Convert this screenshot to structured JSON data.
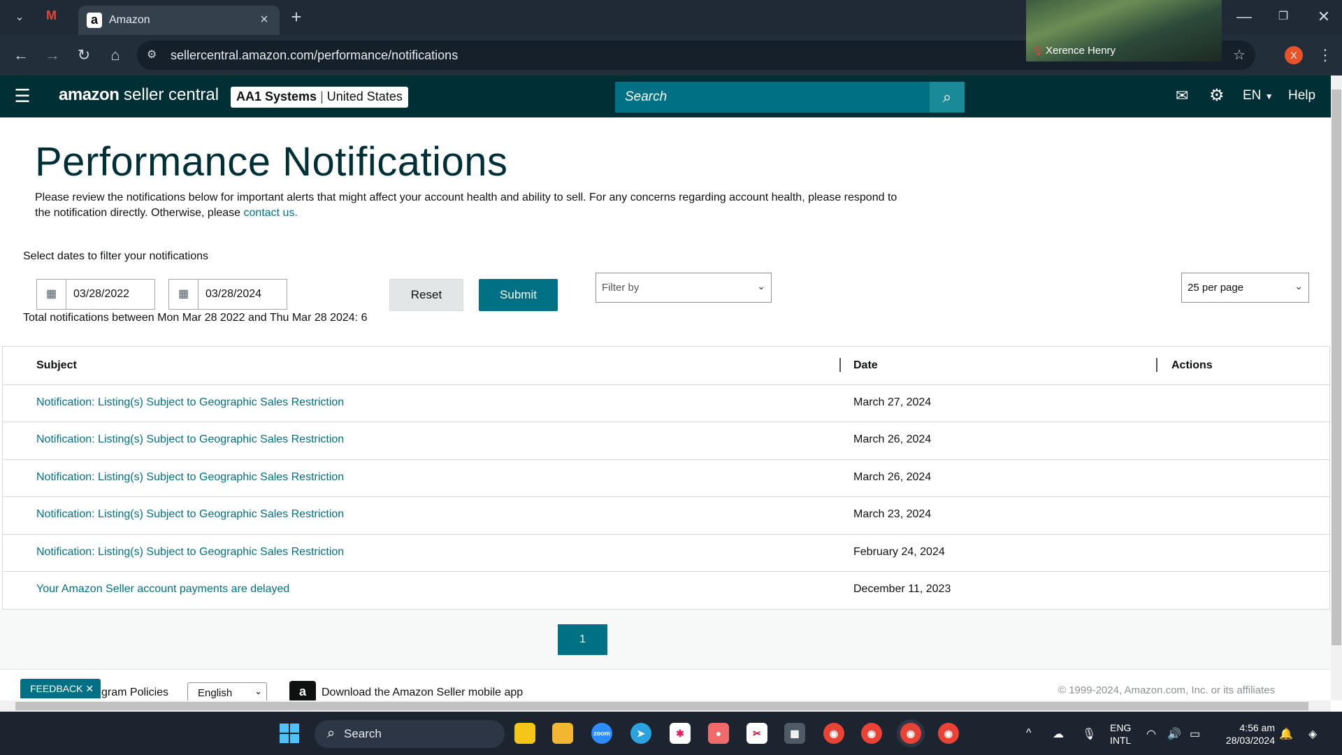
{
  "browser": {
    "tab_title": "Amazon",
    "url": "sellercentral.amazon.com/performance/notifications",
    "video_name": "Xerence Henry",
    "profile_initial": "X"
  },
  "header": {
    "logo_a": "amazon",
    "logo_b": " seller central",
    "account_name": "AA1 Systems",
    "account_region": "United States",
    "search_placeholder": "Search",
    "language": "EN",
    "help": "Help"
  },
  "page": {
    "title": "Performance Notifications",
    "intro_text": "Please review the notifications below for important alerts that might affect your account health and ability to sell. For any concerns regarding account health, please respond to the notification directly. Otherwise, please ",
    "intro_link": "contact us.",
    "filter_label": "Select dates to filter your notifications",
    "date_from": "03/28/2022",
    "date_to": "03/28/2024",
    "reset_label": "Reset",
    "submit_label": "Submit",
    "filter_by": "Filter by",
    "per_page": "25 per page",
    "total_text": "Total notifications between Mon Mar 28 2022 and Thu Mar 28 2024: 6"
  },
  "table": {
    "headers": {
      "subject": "Subject",
      "date": "Date",
      "actions": "Actions"
    },
    "rows": [
      {
        "subject": "Notification: Listing(s) Subject to Geographic Sales Restriction",
        "date": "March 27, 2024"
      },
      {
        "subject": "Notification: Listing(s) Subject to Geographic Sales Restriction",
        "date": "March 26, 2024"
      },
      {
        "subject": "Notification: Listing(s) Subject to Geographic Sales Restriction",
        "date": "March 26, 2024"
      },
      {
        "subject": "Notification: Listing(s) Subject to Geographic Sales Restriction",
        "date": "March 23, 2024"
      },
      {
        "subject": "Notification: Listing(s) Subject to Geographic Sales Restriction",
        "date": "February 24, 2024"
      },
      {
        "subject": "Your Amazon Seller account payments are delayed",
        "date": "December 11, 2023"
      }
    ]
  },
  "pagination": {
    "current": "1"
  },
  "footer": {
    "feedback": "FEEDBACK ✕",
    "program_policies": "gram Policies",
    "language": "English",
    "app_text": "Download the Amazon Seller mobile app",
    "copyright": "© 1999-2024, Amazon.com, Inc. or its affiliates"
  },
  "taskbar": {
    "search": "Search",
    "lang1": "ENG",
    "lang2": "INTL",
    "time": "4:56 am",
    "date": "28/03/2024"
  }
}
